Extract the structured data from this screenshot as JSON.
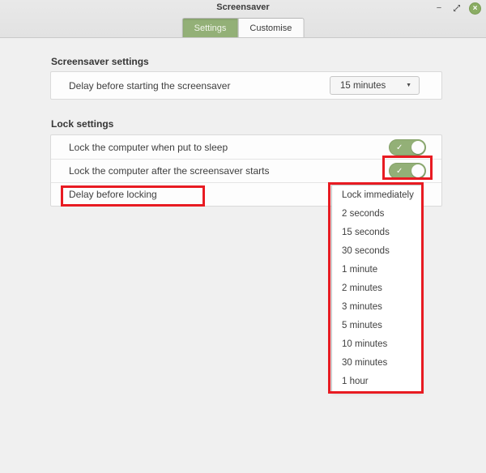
{
  "window": {
    "title": "Screensaver"
  },
  "icons": {
    "minimize": "−",
    "close": "×",
    "check": "✓",
    "dropdown_arrow": "▼"
  },
  "tabs": [
    {
      "label": "Settings",
      "active": true
    },
    {
      "label": "Customise",
      "active": false
    }
  ],
  "sections": {
    "screensaver": {
      "heading": "Screensaver settings",
      "rows": [
        {
          "label": "Delay before starting the screensaver",
          "value": "15 minutes"
        }
      ]
    },
    "lock": {
      "heading": "Lock settings",
      "rows": [
        {
          "label": "Lock the computer when put to sleep",
          "state": "on"
        },
        {
          "label": "Lock the computer after the screensaver starts",
          "state": "on"
        },
        {
          "label": "Delay before locking"
        }
      ]
    }
  },
  "menu": {
    "items": [
      "Lock immediately",
      "2 seconds",
      "15 seconds",
      "30 seconds",
      "1 minute",
      "2 minutes",
      "3 minutes",
      "5 minutes",
      "10 minutes",
      "30 minutes",
      "1 hour"
    ]
  },
  "colors": {
    "accent_green": "#93b077",
    "annotation_red": "#e81b22"
  }
}
